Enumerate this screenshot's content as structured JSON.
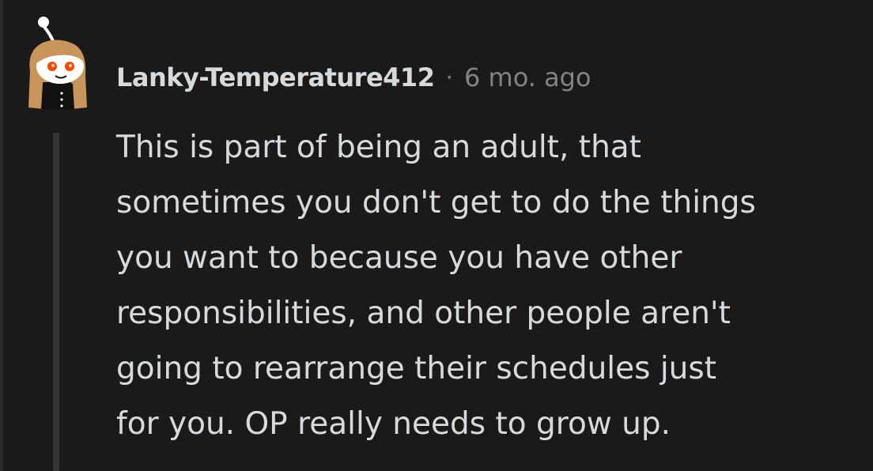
{
  "comment": {
    "username": "Lanky-Temperature412",
    "separator": "·",
    "timestamp": "6 mo. ago",
    "body_lines": [
      "This is part of being an adult, that",
      "sometimes you don't get to do the things",
      "you want to because you have other",
      "responsibilities, and other people aren't",
      "going to rearrange their schedules just",
      "for you. OP really needs to grow up."
    ]
  },
  "colors": {
    "background": "#1a1a1b",
    "text": "#d7dadc",
    "meta_text": "#818384",
    "thread_line": "#343536",
    "avatar_hair": "#c8955a",
    "avatar_eyes": "#ff4500"
  }
}
